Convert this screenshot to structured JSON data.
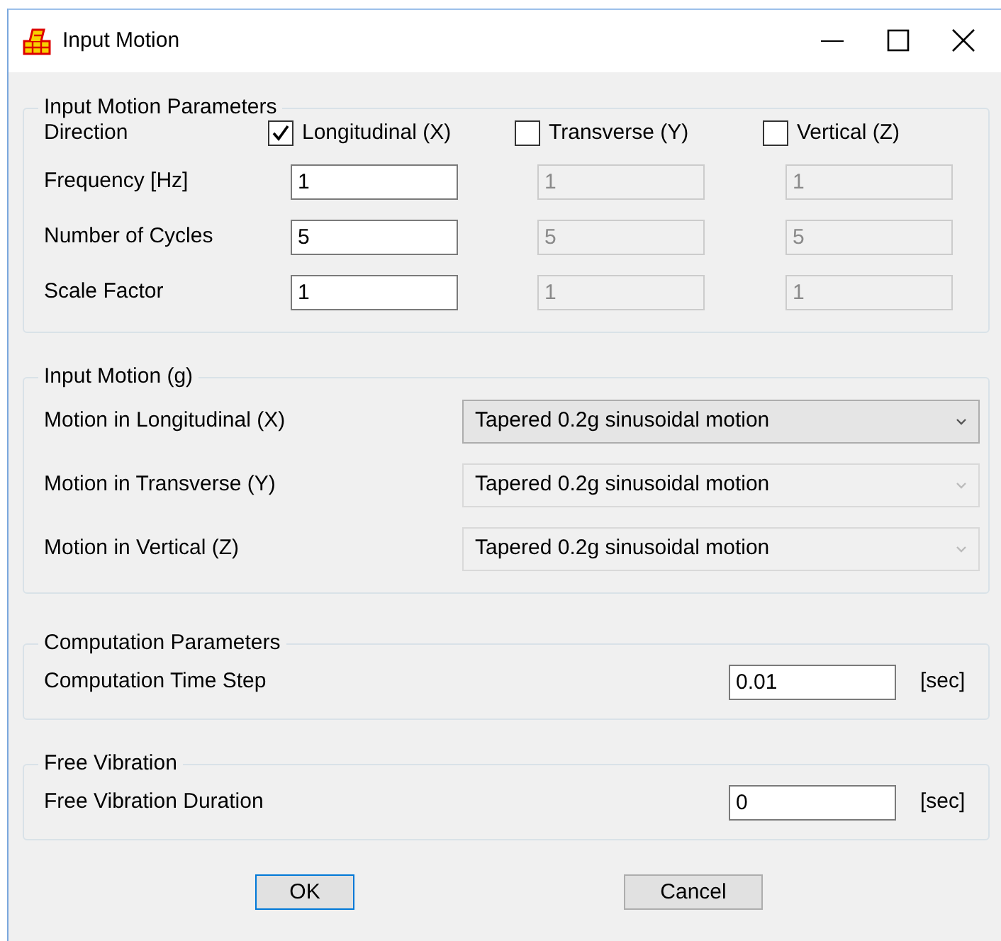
{
  "window": {
    "title": "Input Motion"
  },
  "parameters": {
    "title": "Input Motion Parameters",
    "direction_label": "Direction",
    "directions": [
      {
        "label": "Longitudinal (X)",
        "checked": true
      },
      {
        "label": "Transverse (Y)",
        "checked": false
      },
      {
        "label": "Vertical (Z)",
        "checked": false
      }
    ],
    "rows": [
      {
        "label": "Frequency [Hz]",
        "values": [
          {
            "value": "1",
            "disabled": false
          },
          {
            "value": "1",
            "disabled": true
          },
          {
            "value": "1",
            "disabled": true
          }
        ]
      },
      {
        "label": "Number of Cycles",
        "values": [
          {
            "value": "5",
            "disabled": false
          },
          {
            "value": "5",
            "disabled": true
          },
          {
            "value": "5",
            "disabled": true
          }
        ]
      },
      {
        "label": "Scale Factor",
        "values": [
          {
            "value": "1",
            "disabled": false
          },
          {
            "value": "1",
            "disabled": true
          },
          {
            "value": "1",
            "disabled": true
          }
        ]
      }
    ]
  },
  "input_motion": {
    "title": "Input Motion (g)",
    "rows": [
      {
        "label": "Motion in Longitudinal (X)",
        "value": "Tapered 0.2g sinusoidal motion",
        "disabled": false
      },
      {
        "label": "Motion in Transverse (Y)",
        "value": "Tapered 0.2g sinusoidal motion",
        "disabled": true
      },
      {
        "label": "Motion in Vertical (Z)",
        "value": "Tapered 0.2g sinusoidal motion",
        "disabled": true
      }
    ]
  },
  "computation": {
    "title": "Computation Parameters",
    "label": "Computation Time Step",
    "value": "0.01",
    "unit": "[sec]"
  },
  "free_vibration": {
    "title": "Free Vibration",
    "label": "Free Vibration Duration",
    "value": "0",
    "unit": "[sec]"
  },
  "buttons": [
    {
      "label": "OK",
      "default": true
    },
    {
      "label": "Cancel",
      "default": false
    }
  ]
}
